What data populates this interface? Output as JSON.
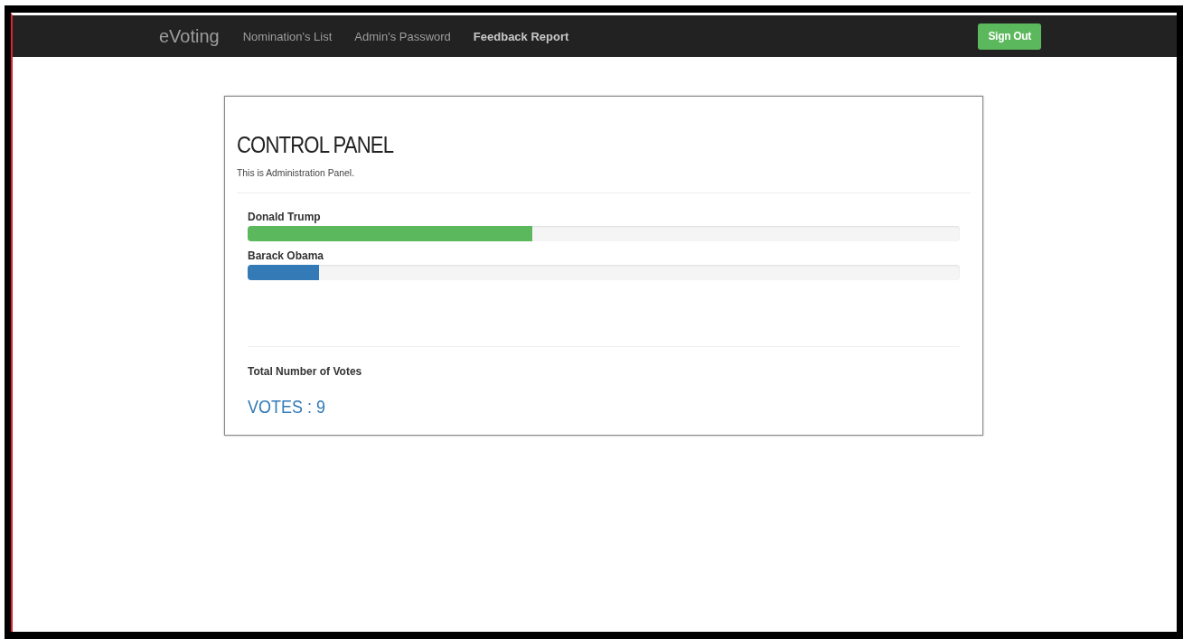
{
  "navbar": {
    "brand": "eVoting",
    "links": [
      {
        "label": "Nomination's List",
        "bold": false
      },
      {
        "label": "Admin's Password",
        "bold": false
      },
      {
        "label": "Feedback Report",
        "bold": true
      }
    ],
    "sign_out": "Sign Out"
  },
  "panel": {
    "title": "CONTROL PANEL",
    "subtitle": "This is Administration Panel.",
    "candidates": [
      {
        "name": "Donald Trump",
        "level": 0.4,
        "color": "#5cb85c"
      },
      {
        "name": "Barack Obama",
        "level": 0.1,
        "color": "#337ab7"
      }
    ],
    "total_label": "Total Number of Votes",
    "total": "VOTES : 9"
  }
}
